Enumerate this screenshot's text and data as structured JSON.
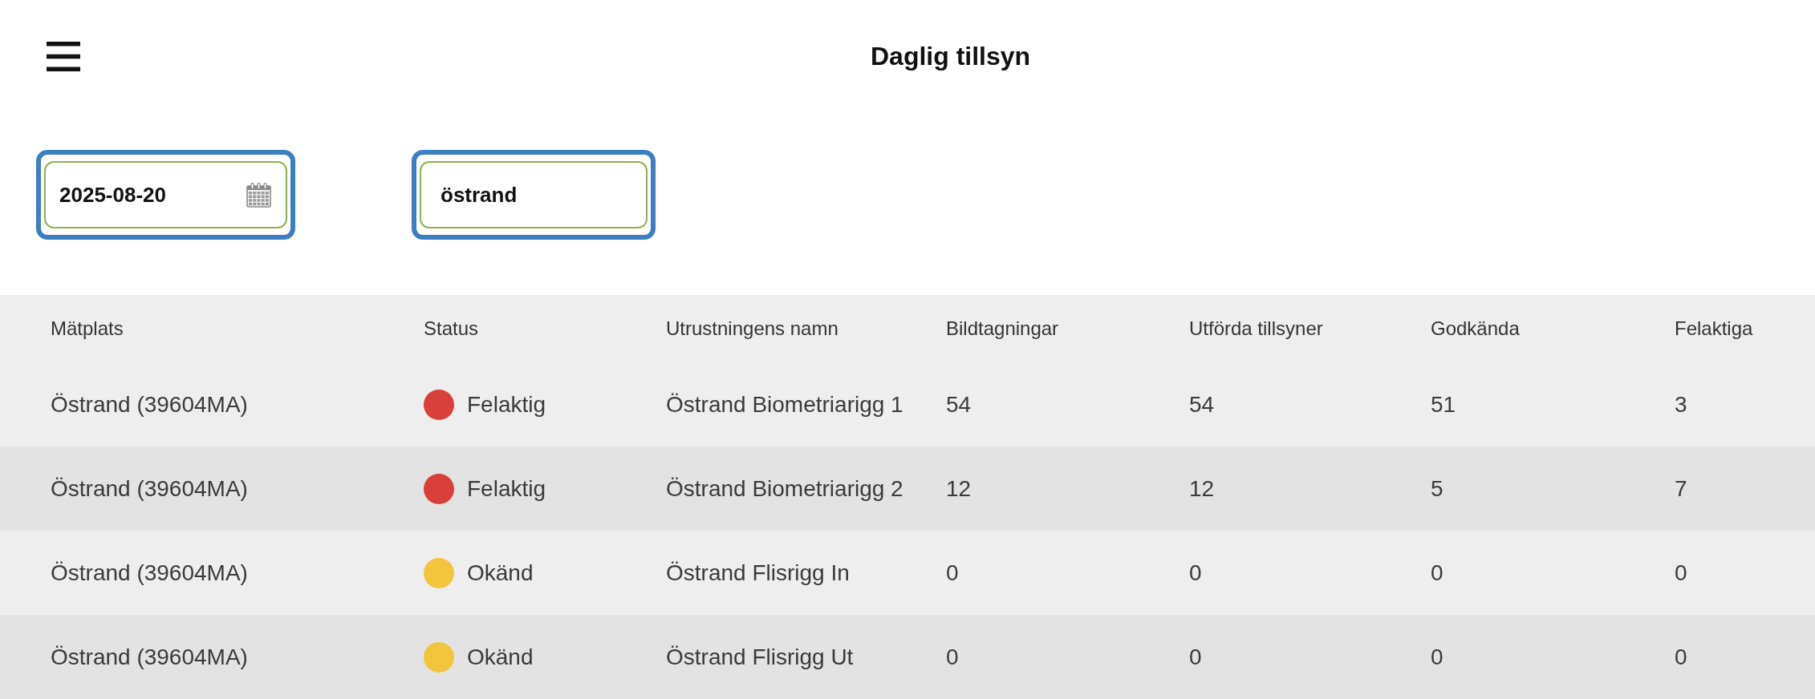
{
  "header": {
    "title": "Daglig tillsyn"
  },
  "filters": {
    "date": {
      "value": "2025-08-20"
    },
    "search": {
      "value": "östrand"
    }
  },
  "table": {
    "columns": [
      "Mätplats",
      "Status",
      "Utrustningens namn",
      "Bildtagningar",
      "Utförda tillsyner",
      "Godkända",
      "Felaktiga"
    ],
    "rows": [
      {
        "location": "Östrand (39604MA)",
        "status": "Felaktig",
        "color": "#d9403a",
        "equipment": "Östrand Biometriarigg 1",
        "counts": [
          "54",
          "54",
          "51",
          "3"
        ]
      },
      {
        "location": "Östrand (39604MA)",
        "status": "Felaktig",
        "color": "#d9403a",
        "equipment": "Östrand Biometriarigg 2",
        "counts": [
          "12",
          "12",
          "5",
          "7"
        ]
      },
      {
        "location": "Östrand (39604MA)",
        "status": "Okänd",
        "color": "#f2c53d",
        "equipment": "Östrand Flisrigg In",
        "counts": [
          "0",
          "0",
          "0",
          "0"
        ]
      },
      {
        "location": "Östrand (39604MA)",
        "status": "Okänd",
        "color": "#f2c53d",
        "equipment": "Östrand Flisrigg Ut",
        "counts": [
          "0",
          "0",
          "0",
          "0"
        ]
      }
    ]
  }
}
